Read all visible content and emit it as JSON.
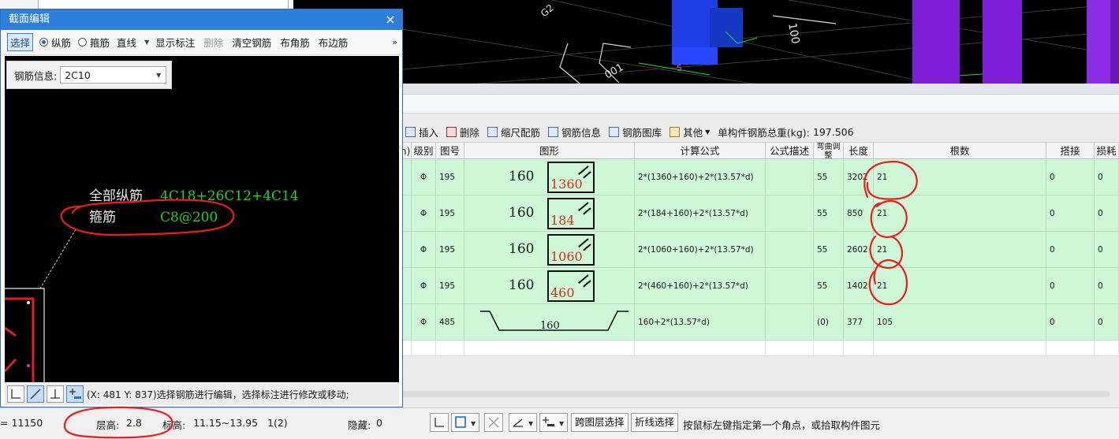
{
  "viewport3d": {
    "labels": [
      "100",
      "001",
      "G2",
      "5"
    ]
  },
  "rebar_toolbar": {
    "insert": "插入",
    "delete": "删除",
    "scale_rebar": "缩尺配筋",
    "rebar_info": "钢筋信息",
    "rebar_library": "钢筋图库",
    "other": "其他",
    "total_weight_label": "单构件钢筋总重(kg):",
    "total_weight_value": "197.506"
  },
  "grid": {
    "headers": {
      "cut": "n)",
      "grade": "级别",
      "figure_no": "图号",
      "shape": "图形",
      "formula": "计算公式",
      "formula_desc": "公式描述",
      "bend_adjust": "弯曲调整",
      "length": "长度",
      "count": "根数",
      "lap": "搭接",
      "loss": "损耗"
    },
    "rows": [
      {
        "grade": "Φ",
        "figure_no": "195",
        "dim_a": "160",
        "dim_b": "1360",
        "formula": "2*(1360+160)+2*(13.57*d)",
        "bend": "55",
        "length": "3202",
        "count": "21",
        "lap": "0",
        "loss": "0"
      },
      {
        "grade": "Φ",
        "figure_no": "195",
        "dim_a": "160",
        "dim_b": "184",
        "formula": "2*(184+160)+2*(13.57*d)",
        "bend": "55",
        "length": "850",
        "count": "21",
        "lap": "0",
        "loss": "0"
      },
      {
        "grade": "Φ",
        "figure_no": "195",
        "dim_a": "160",
        "dim_b": "1060",
        "formula": "2*(1060+160)+2*(13.57*d)",
        "bend": "55",
        "length": "2602",
        "count": "21",
        "lap": "0",
        "loss": "0"
      },
      {
        "grade": "Φ",
        "figure_no": "195",
        "dim_a": "160",
        "dim_b": "460",
        "formula": "2*(460+160)+2*(13.57*d)",
        "bend": "55",
        "length": "1402",
        "count": "21",
        "lap": "0",
        "loss": "0"
      },
      {
        "grade": "Φ",
        "figure_no": "485",
        "dim_a": "160",
        "formula": "160+2*(13.57*d)",
        "bend": "(0)",
        "length": "377",
        "count": "105",
        "lap": "0",
        "loss": "0"
      }
    ]
  },
  "dialog": {
    "title": "截面编辑",
    "close": "×",
    "toolbar": {
      "select": "选择",
      "longitudinal": "纵筋",
      "stirrup": "箍筋",
      "line_mode": "直线",
      "show_annotation": "显示标注",
      "delete": "删除",
      "clear_rebar": "清空钢筋",
      "corner_rebar": "布角筋",
      "edge_rebar": "布边筋",
      "more": "»"
    },
    "info_label": "钢筋信息:",
    "info_value": "2C10",
    "annotation": {
      "all_longitudinal_label": "全部纵筋",
      "all_longitudinal_value": "4C18+26C12+4C14",
      "stirrup_label": "箍筋",
      "stirrup_value": "C8@200"
    },
    "status_text": "(X: 481 Y: 837)选择钢筋进行编辑，选择标注进行修改或移动;"
  },
  "statusbar": {
    "elevation_prefix": "= 11150",
    "floor_height_label": "层高:",
    "floor_height_value": "2.8",
    "elevation_label": "标高:",
    "elevation_value": "11.15~13.95",
    "layer_count": "1(2)",
    "hidden_label": "隐藏:",
    "hidden_value": "0",
    "cross_layer_select": "跨图层选择",
    "polyline_select": "折线选择",
    "hint": "按鼠标左键指定第一个角点，或拾取构件图元"
  }
}
